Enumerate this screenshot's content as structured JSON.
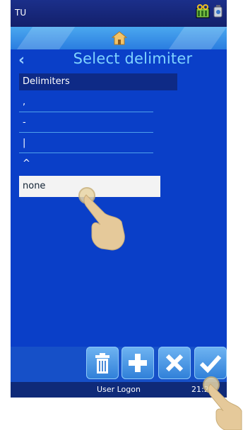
{
  "topbar": {
    "title": "TU"
  },
  "screen": {
    "title": "Select delimiter"
  },
  "list": {
    "header": "Delimiters",
    "items": [
      ",",
      "-",
      "|",
      "^"
    ],
    "selected": "none"
  },
  "bottombar": {
    "user_logon": "User Logon",
    "clock": "21:2"
  },
  "icons": {
    "status_left": "battery-level-icon",
    "status_right": "network-icon",
    "home": "home-icon",
    "back": "chevron-left-icon",
    "toolbar": [
      "trash-icon",
      "plus-icon",
      "close-icon",
      "check-icon"
    ],
    "pointers": [
      "hand-pointer-icon",
      "hand-pointer-icon"
    ]
  },
  "colors": {
    "background": "#0a3fc8",
    "title": "#7fd3ff",
    "header_bar": "#0e2a86",
    "selected_row": "#f3f3f3"
  }
}
